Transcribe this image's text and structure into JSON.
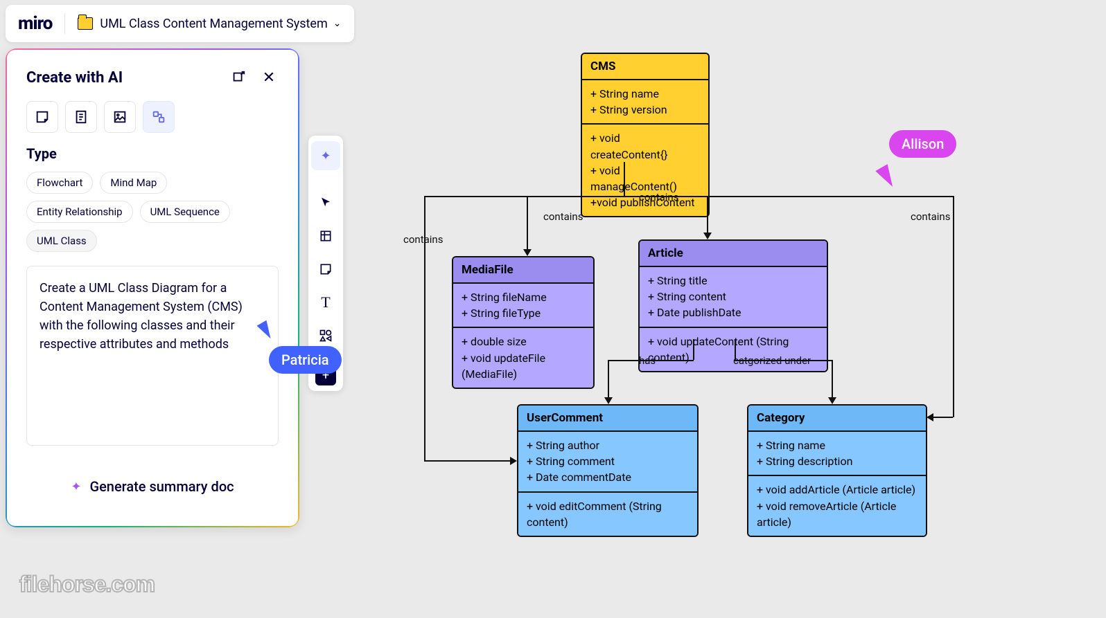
{
  "header": {
    "logo": "miro",
    "board_title": "UML Class Content Management System"
  },
  "ai_panel": {
    "title": "Create with AI",
    "type_label": "Type",
    "chips": [
      "Flowchart",
      "Mind Map",
      "Entity Relationship",
      "UML Sequence",
      "UML Class"
    ],
    "selected_chip": "UML Class",
    "prompt": "Create a UML Class Diagram for a Content Management System (CMS) with the following classes and their respective attributes and methods",
    "generate_label": "Generate summary doc"
  },
  "cursors": {
    "patricia": "Patricia",
    "allison": "Allison"
  },
  "uml": {
    "cms": {
      "name": "CMS",
      "attrs": "+ String name\n+ String version",
      "methods": "+ void createContent{}\n+ void manageContent()\n+void publishContent"
    },
    "mediafile": {
      "name": "MediaFile",
      "attrs": "+ String fileName\n+ String fileType",
      "methods": "+ double size\n+ void updateFile (MediaFile)"
    },
    "article": {
      "name": "Article",
      "attrs": "+ String title\n+ String content\n+ Date publishDate",
      "methods": "+ void updateContent (String content)"
    },
    "usercomment": {
      "name": "UserComment",
      "attrs": "+ String author\n+ String comment\n+ Date commentDate",
      "methods": "+ void editComment (String content)"
    },
    "category": {
      "name": "Category",
      "attrs": "+ String name\n+ String description",
      "methods": "+ void addArticle (Article article)\n+ void removeArticle (Article article)"
    }
  },
  "labels": {
    "contains": "contains",
    "has": "has",
    "catunder": "catgorized under"
  },
  "watermark": "filehorse.com"
}
